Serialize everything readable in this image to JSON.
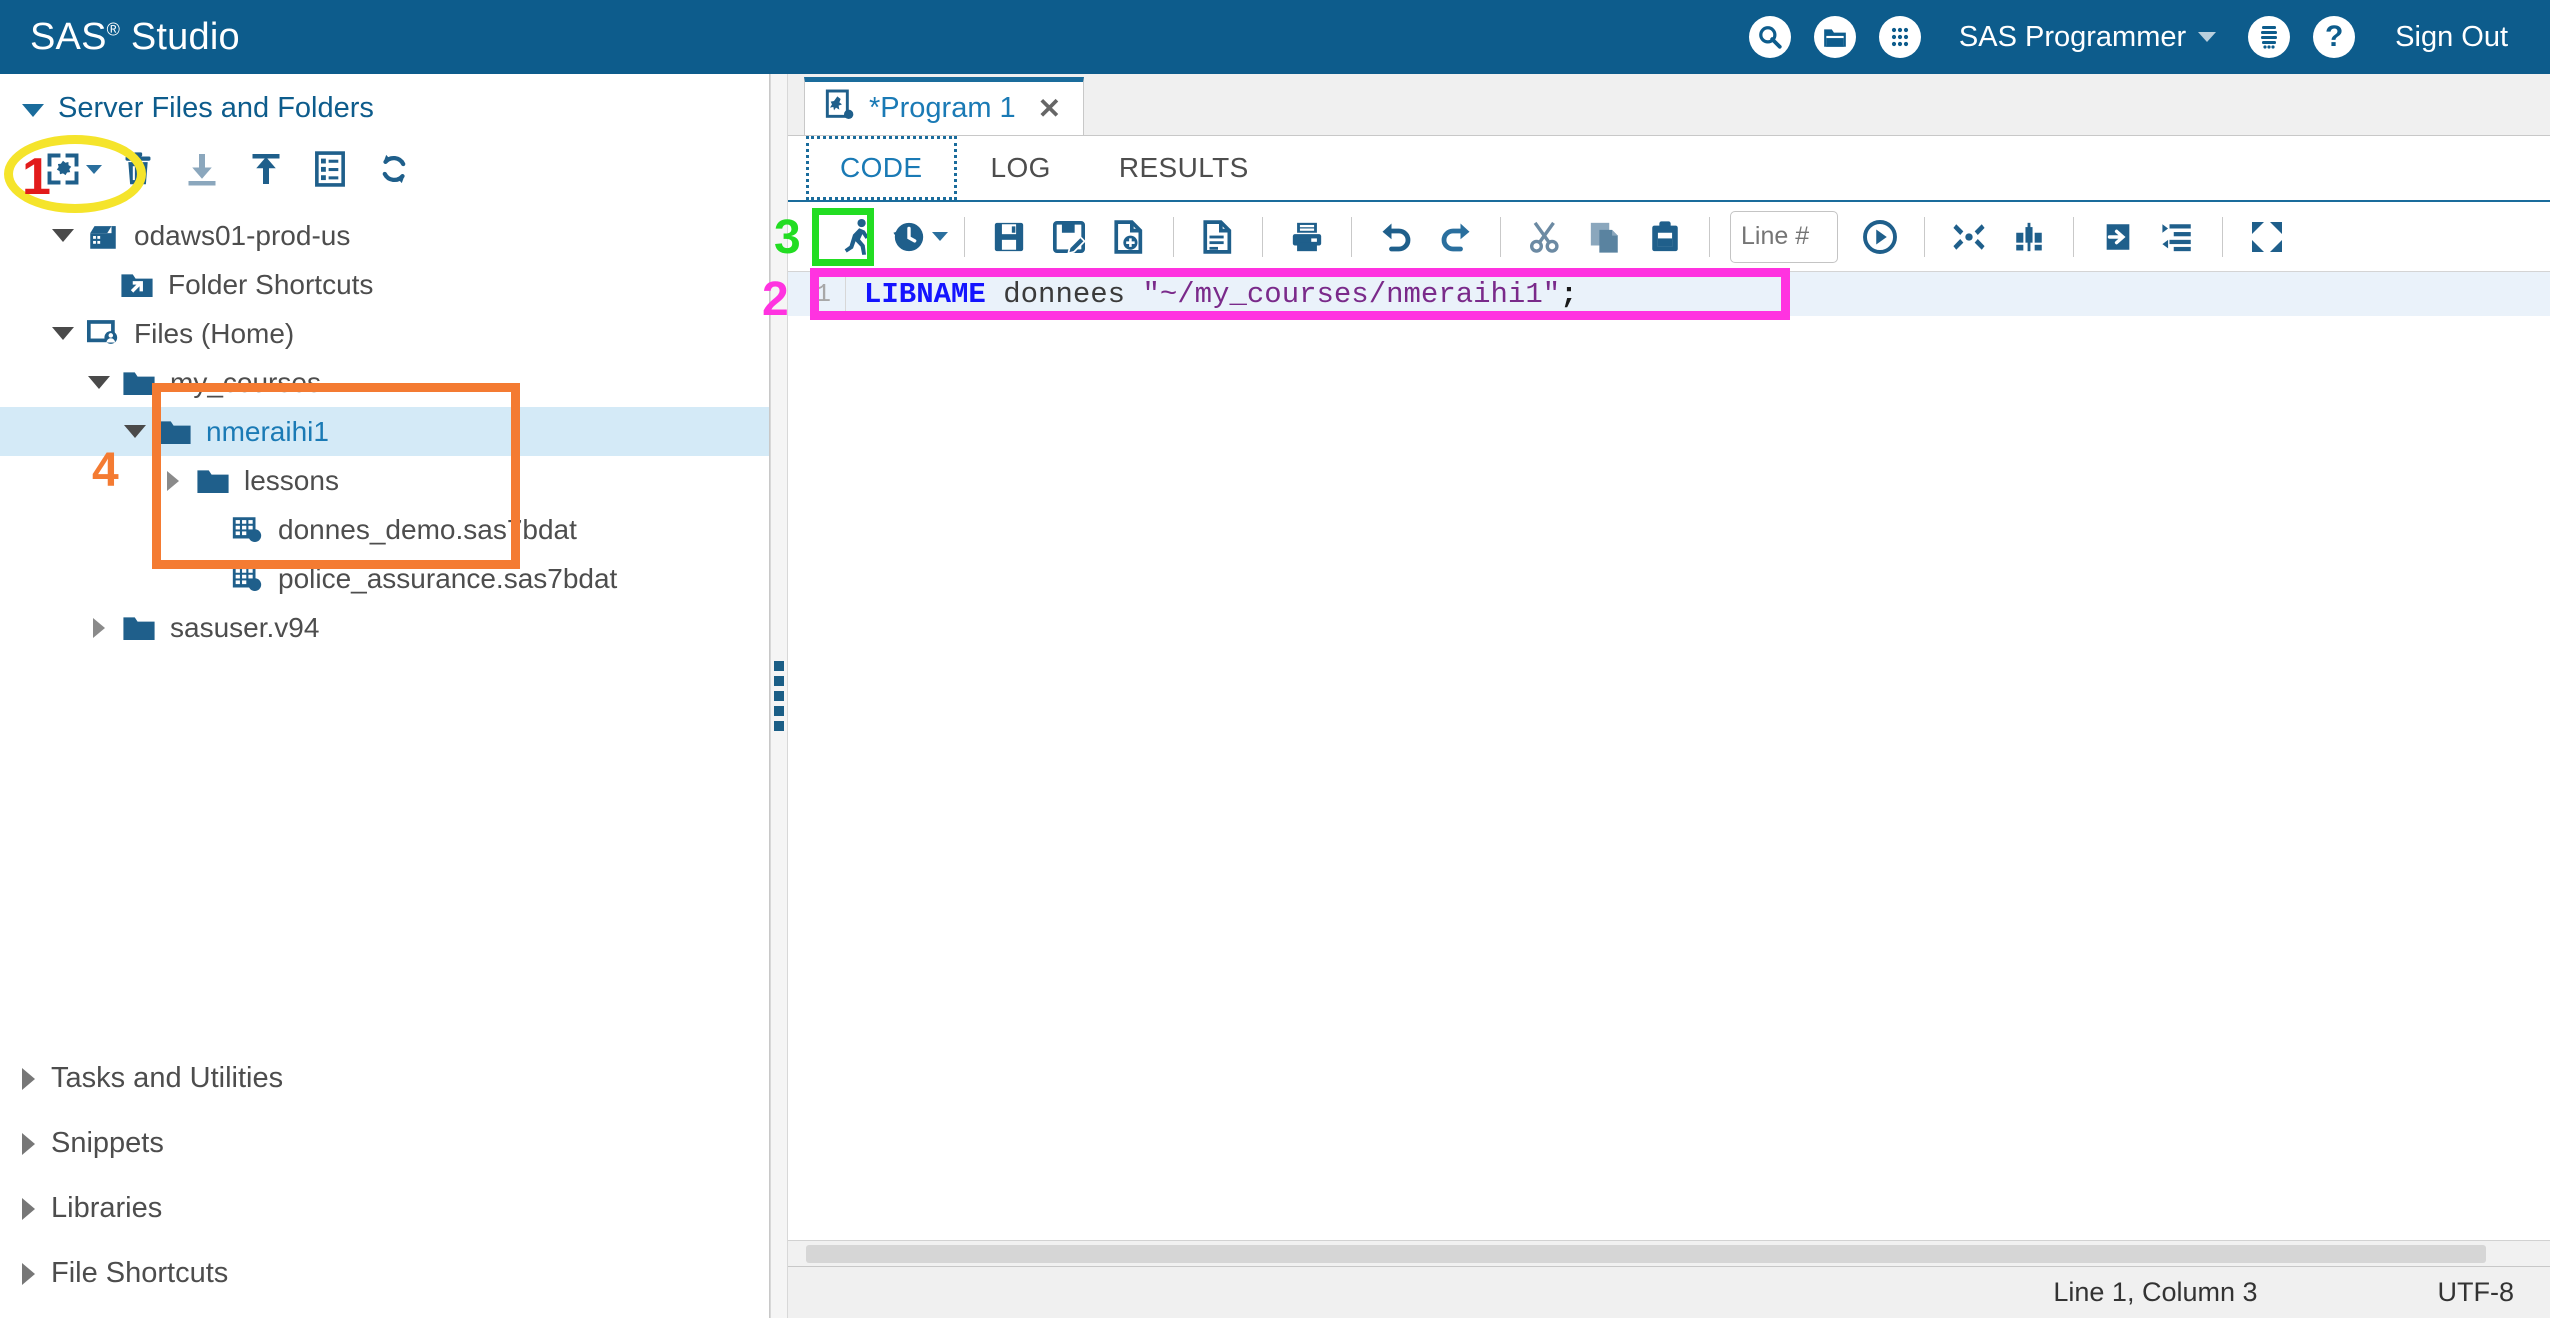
{
  "banner": {
    "brand_text": "SAS",
    "brand_sup": "®",
    "brand_suffix": " Studio",
    "icons": [
      {
        "name": "search-icon",
        "glyph": "⚲"
      },
      {
        "name": "open-folder-icon",
        "glyph": "▣"
      },
      {
        "name": "apps-grid-icon",
        "glyph": "∷"
      }
    ],
    "user_label": "SAS Programmer",
    "options_icon": "options-icon",
    "help_icon": "help-icon",
    "help_glyph": "?",
    "signout_label": "Sign Out",
    "background_color": "#0d5c8c"
  },
  "sidebar": {
    "section_title": "Server Files and Folders",
    "toolbar": [
      {
        "name": "new-item-button",
        "label": "New",
        "has_dropdown": true
      },
      {
        "name": "delete-button",
        "label": "Delete"
      },
      {
        "name": "download-button",
        "label": "Download"
      },
      {
        "name": "upload-button",
        "label": "Upload"
      },
      {
        "name": "properties-button",
        "label": "Properties"
      },
      {
        "name": "refresh-button",
        "label": "Refresh"
      }
    ],
    "tree": [
      {
        "label": "odaws01-prod-us",
        "icon": "server-icon",
        "depth": 0,
        "twist": "down",
        "selected": false
      },
      {
        "label": "Folder Shortcuts",
        "icon": "folder-shortcut-icon",
        "depth": 1,
        "twist": "none",
        "selected": false
      },
      {
        "label": "Files (Home)",
        "icon": "home-files-icon",
        "depth": 1,
        "twist": "down",
        "selected": false
      },
      {
        "label": "my_courses",
        "icon": "folder-icon",
        "depth": 2,
        "twist": "down",
        "selected": false
      },
      {
        "label": "nmeraihi1",
        "icon": "folder-icon",
        "depth": 3,
        "twist": "down",
        "selected": true
      },
      {
        "label": "lessons",
        "icon": "folder-icon",
        "depth": 4,
        "twist": "right",
        "selected": false
      },
      {
        "label": "donnes_demo.sas7bdat",
        "icon": "sas-dataset-icon",
        "depth": 4,
        "twist": "none",
        "selected": false
      },
      {
        "label": "police_assurance.sas7bdat",
        "icon": "sas-dataset-icon",
        "depth": 4,
        "twist": "none",
        "selected": false
      },
      {
        "label": "sasuser.v94",
        "icon": "folder-icon",
        "depth": 2,
        "twist": "right",
        "selected": false
      }
    ],
    "collapsed_sections": [
      {
        "label": "Tasks and Utilities"
      },
      {
        "label": "Snippets"
      },
      {
        "label": "Libraries"
      },
      {
        "label": "File Shortcuts"
      }
    ]
  },
  "workarea": {
    "document_tab": {
      "label": "*Program 1",
      "icon": "sas-program-icon",
      "close_glyph": "✕"
    },
    "subtabs": [
      {
        "label": "CODE",
        "active": true
      },
      {
        "label": "LOG",
        "active": false
      },
      {
        "label": "RESULTS",
        "active": false
      }
    ],
    "editor_toolbar": [
      {
        "name": "run-button",
        "label": "Run"
      },
      {
        "name": "history-button",
        "label": "Submission History",
        "has_dropdown": true
      },
      {
        "name": "save-button",
        "label": "Save"
      },
      {
        "name": "save-as-button",
        "label": "Save As"
      },
      {
        "name": "add-to-my-snippets-button",
        "label": "Add to My Snippets"
      },
      {
        "name": "program-summary-button",
        "label": "Program Summary"
      },
      {
        "name": "print-button",
        "label": "Print"
      },
      {
        "name": "undo-button",
        "label": "Undo"
      },
      {
        "name": "redo-button",
        "label": "Redo"
      },
      {
        "name": "cut-button",
        "label": "Cut"
      },
      {
        "name": "copy-button",
        "label": "Copy"
      },
      {
        "name": "paste-button",
        "label": "Paste"
      },
      {
        "name": "goto-line-button",
        "label": "Go To Line"
      },
      {
        "name": "clear-all-button",
        "label": "Clear All"
      },
      {
        "name": "find-replace-button",
        "label": "Find and Replace"
      },
      {
        "name": "indent-button",
        "label": "Indent"
      },
      {
        "name": "format-code-button",
        "label": "Format Code"
      },
      {
        "name": "maximize-view-button",
        "label": "Maximize View"
      }
    ],
    "line_number_input": {
      "value": "",
      "placeholder": "Line #"
    },
    "code": {
      "line_number": "1",
      "keyword": "LIBNAME",
      "libref": " donnees ",
      "path_string": "\"~/my_courses/nmeraihi1\"",
      "terminator": ";",
      "full_text": "LIBNAME donnees \"~/my_courses/nmeraihi1\";"
    },
    "statusbar": {
      "cursor_position": "Line 1, Column 3",
      "encoding": "UTF-8"
    }
  },
  "annotations": [
    {
      "name": "annotation-1",
      "number": "1",
      "shape": "ellipse",
      "color": "#f5e42b",
      "number_color": "#e21b1b",
      "target": "new-item-button"
    },
    {
      "name": "annotation-2",
      "number": "2",
      "shape": "rectangle",
      "color": "#ff33e0",
      "number_color": "#ff33e0",
      "target": "code-line"
    },
    {
      "name": "annotation-3",
      "number": "3",
      "shape": "rectangle",
      "color": "#22dd22",
      "number_color": "#22dd22",
      "target": "run-button"
    },
    {
      "name": "annotation-4",
      "number": "4",
      "shape": "rectangle",
      "color": "#f47b32",
      "number_color": "#f47b32",
      "target": "nmeraihi1-folder-contents"
    }
  ]
}
